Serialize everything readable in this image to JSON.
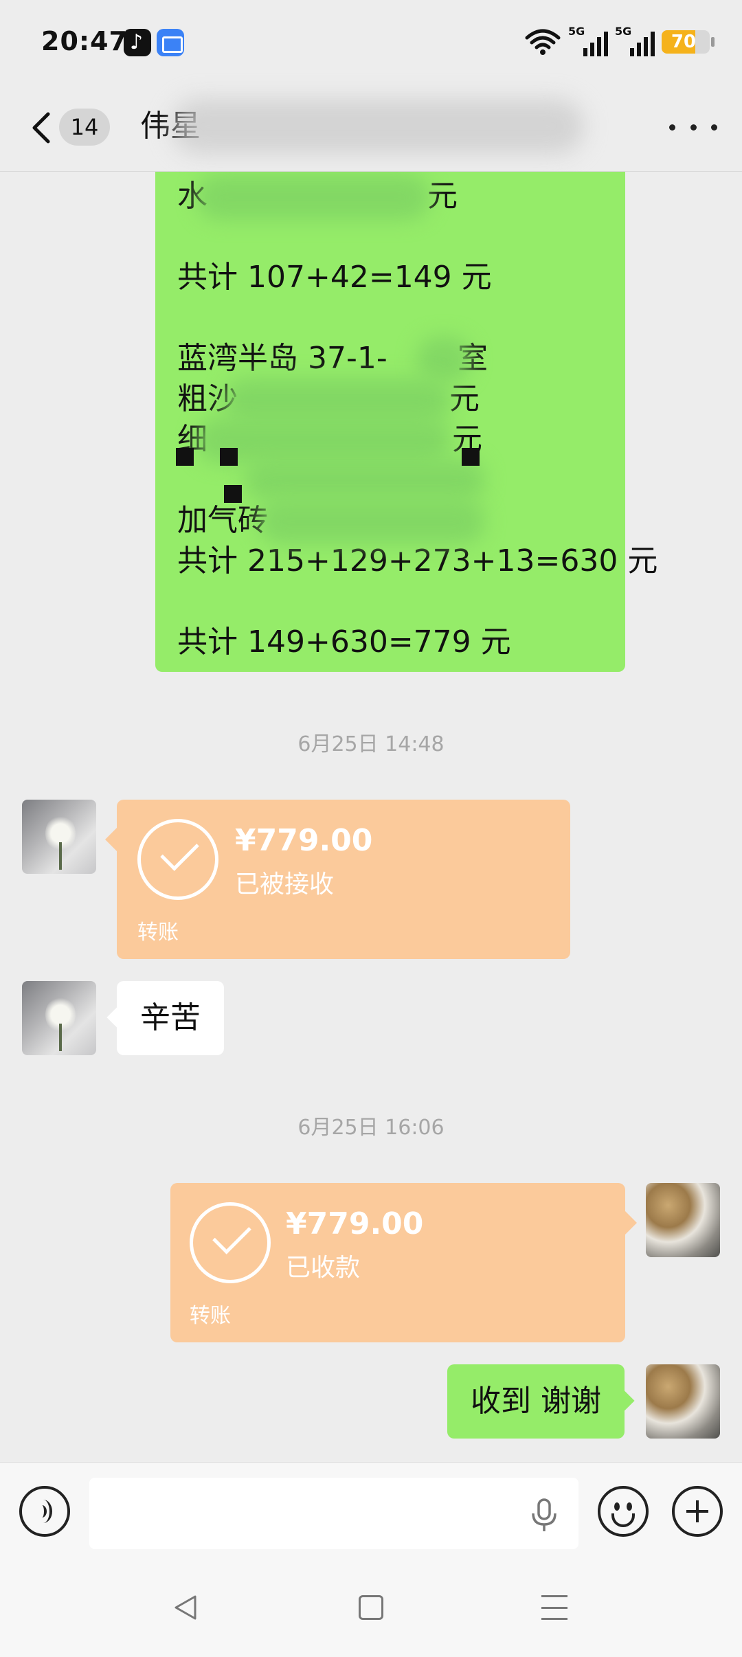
{
  "status_bar": {
    "time": "20:47",
    "app_icons": [
      "tiktok-icon",
      "files-icon"
    ],
    "signal_1_label": "5G",
    "signal_2_label": "5G",
    "battery_level": "70",
    "battery_color": "#f5b21b"
  },
  "header": {
    "unread_count": "14",
    "title_visible": "伟星"
  },
  "messages": {
    "invoice_lines": [
      "水",
      "元",
      "共计 107+42=149 元",
      "蓝湾半岛 37-1-",
      "室",
      "粗沙",
      "元",
      "细",
      "元",
      "加气砖",
      "共计 215+129+273+13=630 元",
      "共计 149+630=779 元"
    ],
    "timestamp_1": "6月25日 14:48",
    "transfer_1": {
      "amount": "¥779.00",
      "status": "已被接收",
      "label": "转账"
    },
    "reply_text": "辛苦",
    "timestamp_2": "6月25日 16:06",
    "transfer_2": {
      "amount": "¥779.00",
      "status": "已收款",
      "label": "转账"
    },
    "my_reply_text": "收到 谢谢"
  },
  "input_bar": {
    "placeholder": ""
  },
  "colors": {
    "background": "#ededed",
    "my_bubble": "#95ec69",
    "transfer_card": "#fbca9b",
    "timestamp_text": "#a6a6a6"
  }
}
